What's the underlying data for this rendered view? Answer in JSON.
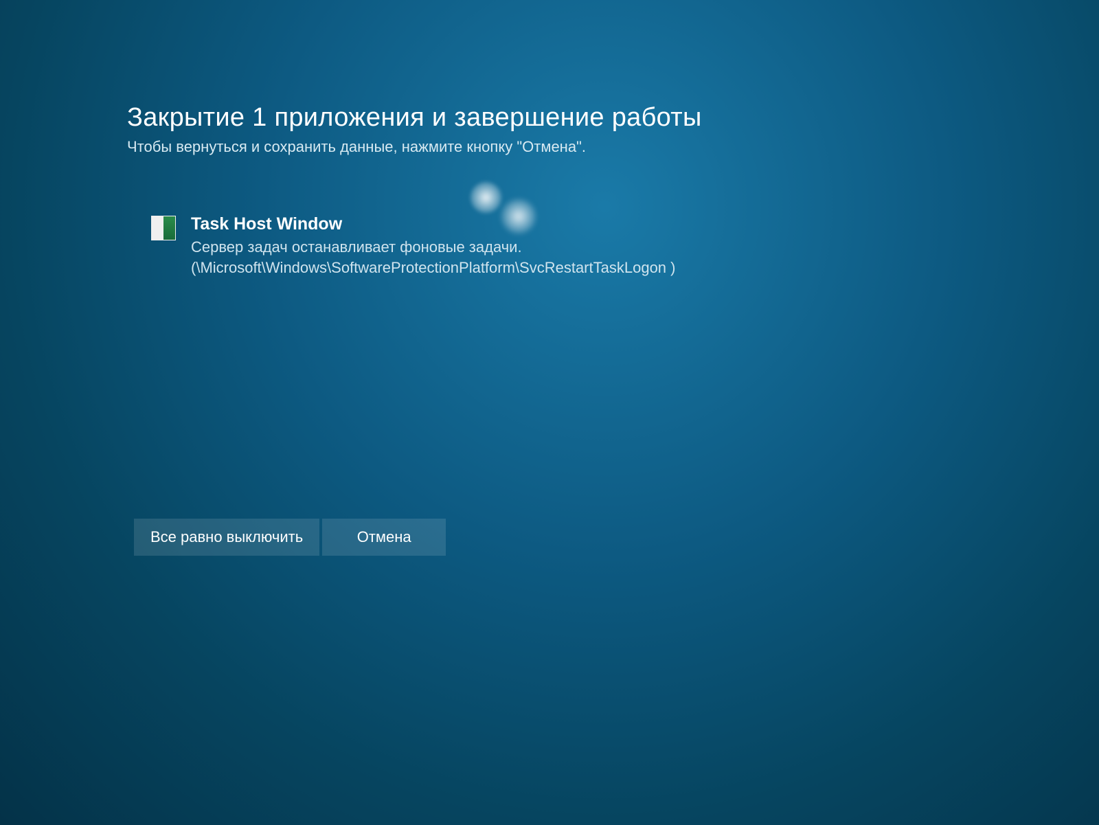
{
  "shutdown": {
    "title": "Закрытие 1 приложения и завершение работы",
    "subtitle": "Чтобы вернуться и сохранить данные, нажмите кнопку \"Отмена\".",
    "apps": [
      {
        "name": "Task Host Window",
        "description": "Сервер задач останавливает фоновые задачи. (\\Microsoft\\Windows\\SoftwareProtectionPlatform\\SvcRestartTaskLogon )"
      }
    ],
    "buttons": {
      "force_shutdown": "Все равно выключить",
      "cancel": "Отмена"
    }
  }
}
